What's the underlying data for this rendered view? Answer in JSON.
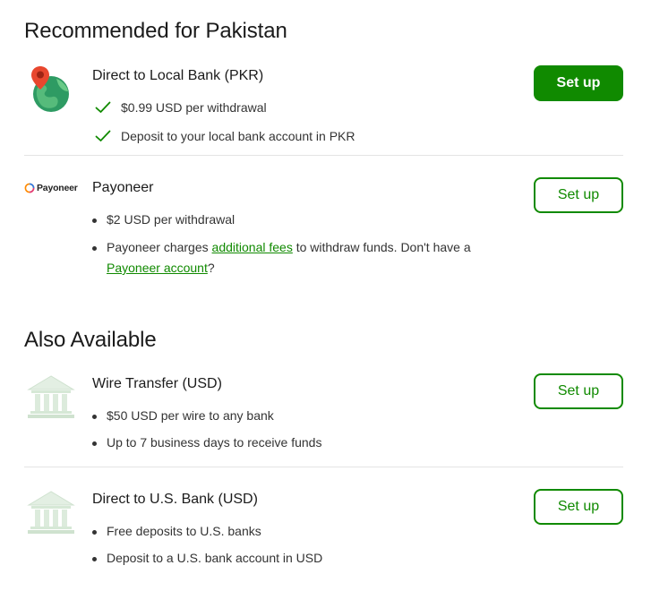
{
  "sections": {
    "recommended_title": "Recommended for Pakistan",
    "also_title": "Also Available"
  },
  "methods": [
    {
      "name": "Direct to Local Bank (PKR)",
      "icon": "globe-map-pin-icon",
      "features": [
        "$0.99 USD per withdrawal",
        "Deposit to your local bank account in PKR"
      ],
      "button": "Set up"
    },
    {
      "name": "Payoneer",
      "icon": "payoneer-logo",
      "logo_text": "Payoneer",
      "features": [
        "$2 USD per withdrawal"
      ],
      "note": {
        "pre": "Payoneer charges ",
        "link1": "additional fees",
        "mid": " to withdraw funds. Don't have a",
        "link2": "Payoneer account",
        "post": "?"
      },
      "button": "Set up"
    },
    {
      "name": "Wire Transfer (USD)",
      "icon": "bank-building-icon",
      "features": [
        "$50 USD per wire to any bank",
        "Up to 7 business days to receive funds"
      ],
      "button": "Set up"
    },
    {
      "name": "Direct to U.S. Bank (USD)",
      "icon": "bank-building-icon",
      "features": [
        "Free deposits to U.S. banks",
        "Deposit to a U.S. bank account in USD"
      ],
      "button": "Set up"
    }
  ],
  "colors": {
    "accent": "#108a00",
    "divider": "#e4e4e4",
    "text": "#1b1b1b"
  }
}
